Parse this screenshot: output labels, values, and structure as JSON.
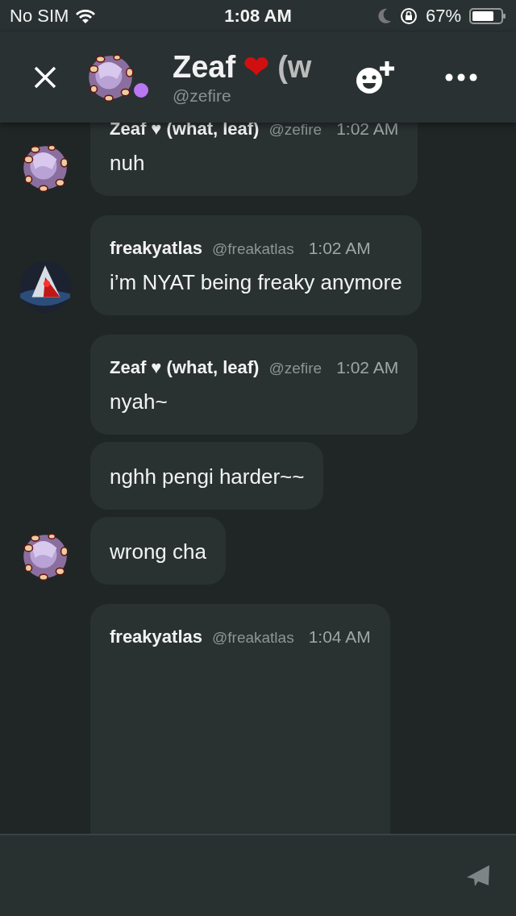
{
  "status_bar": {
    "carrier": "No SIM",
    "time": "1:08 AM",
    "battery": "67%"
  },
  "header": {
    "title": "Zeaf",
    "title_emoji": "❤",
    "title_rest": "(w",
    "handle": "@zefire"
  },
  "messages": [
    {
      "avatar": {
        "color": "#8a6f9e"
      },
      "author": "Zeaf ♥ (what, leaf)",
      "handle": "@zefire",
      "time": "1:02 AM",
      "text": "nuh"
    },
    {
      "avatar": {
        "color": "#1c2230"
      },
      "author": "freakyatlas",
      "handle": "@freakatlas",
      "time": "1:02 AM",
      "text": "i’m NYAT being freaky anymore"
    },
    {
      "author": "Zeaf ♥ (what, leaf)",
      "handle": "@zefire",
      "time": "1:02 AM",
      "text": "nyah~"
    },
    {
      "text": "nghh pengi harder~~"
    },
    {
      "avatar": {
        "color": "#8a6f9e"
      },
      "text": "wrong cha"
    },
    {
      "author": "freakyatlas",
      "handle": "@freakatlas",
      "time": "1:04 AM"
    }
  ]
}
